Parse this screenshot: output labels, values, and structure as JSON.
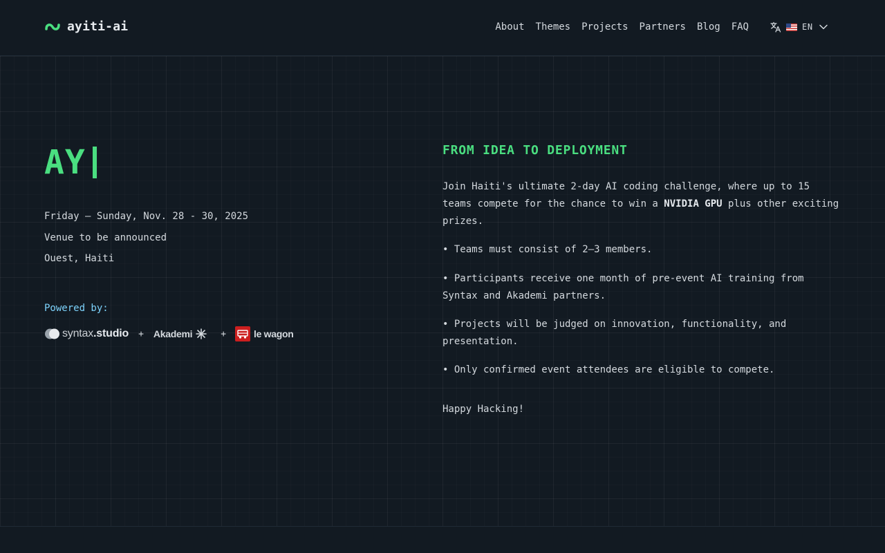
{
  "header": {
    "brand": "ayiti-ai",
    "nav": [
      "About",
      "Themes",
      "Projects",
      "Partners",
      "Blog",
      "FAQ"
    ],
    "language": {
      "flag": "🇺🇸",
      "code": "EN"
    }
  },
  "hero": {
    "title": "AY",
    "date": "Friday – Sunday, Nov. 28 - 30, 2025",
    "venue": "Venue to be announced",
    "location": "Ouest, Haiti"
  },
  "powered": {
    "label": "Powered by:",
    "plus": "+",
    "syntax_light": "syntax",
    "syntax_bold": ".studio",
    "akademi": "Akademi",
    "lewagon": "le wagon"
  },
  "details": {
    "heading": "FROM IDEA TO DEPLOYMENT",
    "intro_start": "Join Haiti's ultimate 2-day AI coding challenge, where up to 15 teams compete for the chance to win a ",
    "intro_bold": "NVIDIA GPU",
    "intro_end": " plus other exciting prizes.",
    "rules": [
      "• Teams must consist of 2–3 members.",
      "• Participants receive one month of pre-event AI training from Syntax and Akademi partners.",
      "• Projects will be judged on innovation, functionality, and presentation.",
      "• Only confirmed event attendees are eligible to compete."
    ],
    "closing": "Happy Hacking!"
  },
  "colors": {
    "accent": "#4ade80",
    "powered": "#7dd3fc",
    "background": "#121a22"
  }
}
